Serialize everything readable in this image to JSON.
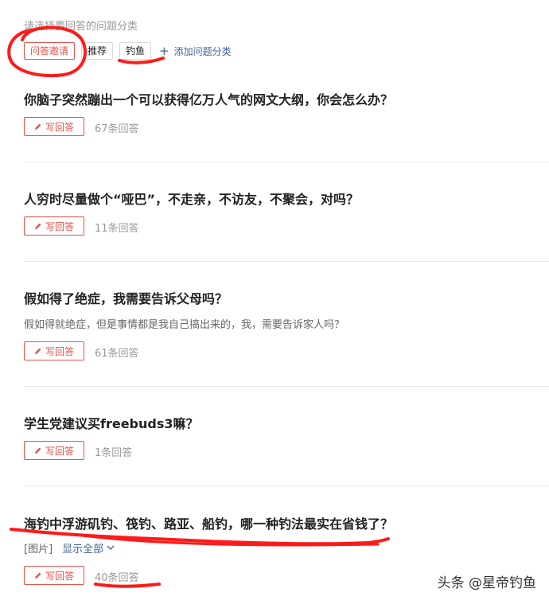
{
  "header": {
    "hint": "请选择要回答的问题分类",
    "tabs": [
      {
        "label": "问答邀请",
        "active": true
      },
      {
        "label": "推荐",
        "active": false
      },
      {
        "label": "钓鱼",
        "active": false
      }
    ],
    "add_category": "添加问题分类"
  },
  "write_icon": "pencil-icon",
  "questions": [
    {
      "title": "你脑子突然蹦出一个可以获得亿万人气的网文大纲，你会怎么办？",
      "write_label": "写回答",
      "count": "67条回答"
    },
    {
      "title": "人穷时尽量做个“哑巴”，不走亲，不访友，不聚会，对吗？",
      "write_label": "写回答",
      "count": "11条回答"
    },
    {
      "title": "假如得了绝症，我需要告诉父母吗？",
      "desc": "假如得就绝症，但是事情都是我自己搞出来的，我，需要告诉家人吗？",
      "write_label": "写回答",
      "count": "61条回答"
    },
    {
      "title": "学生党建议买freebuds3嘛？",
      "write_label": "写回答",
      "count": "1条回答"
    },
    {
      "title": "海钓中浮游矶钓、筏钓、路亚、船钓，哪一种钓法最实在省钱了？",
      "image_tag": "[图片]",
      "show_all": "显示全部",
      "write_label": "写回答",
      "count": "40条回答"
    }
  ],
  "watermark": "头条 @星帝钓鱼",
  "colors": {
    "accent": "#e8524a",
    "link": "#406599",
    "annotation": "#ff1a1a"
  }
}
